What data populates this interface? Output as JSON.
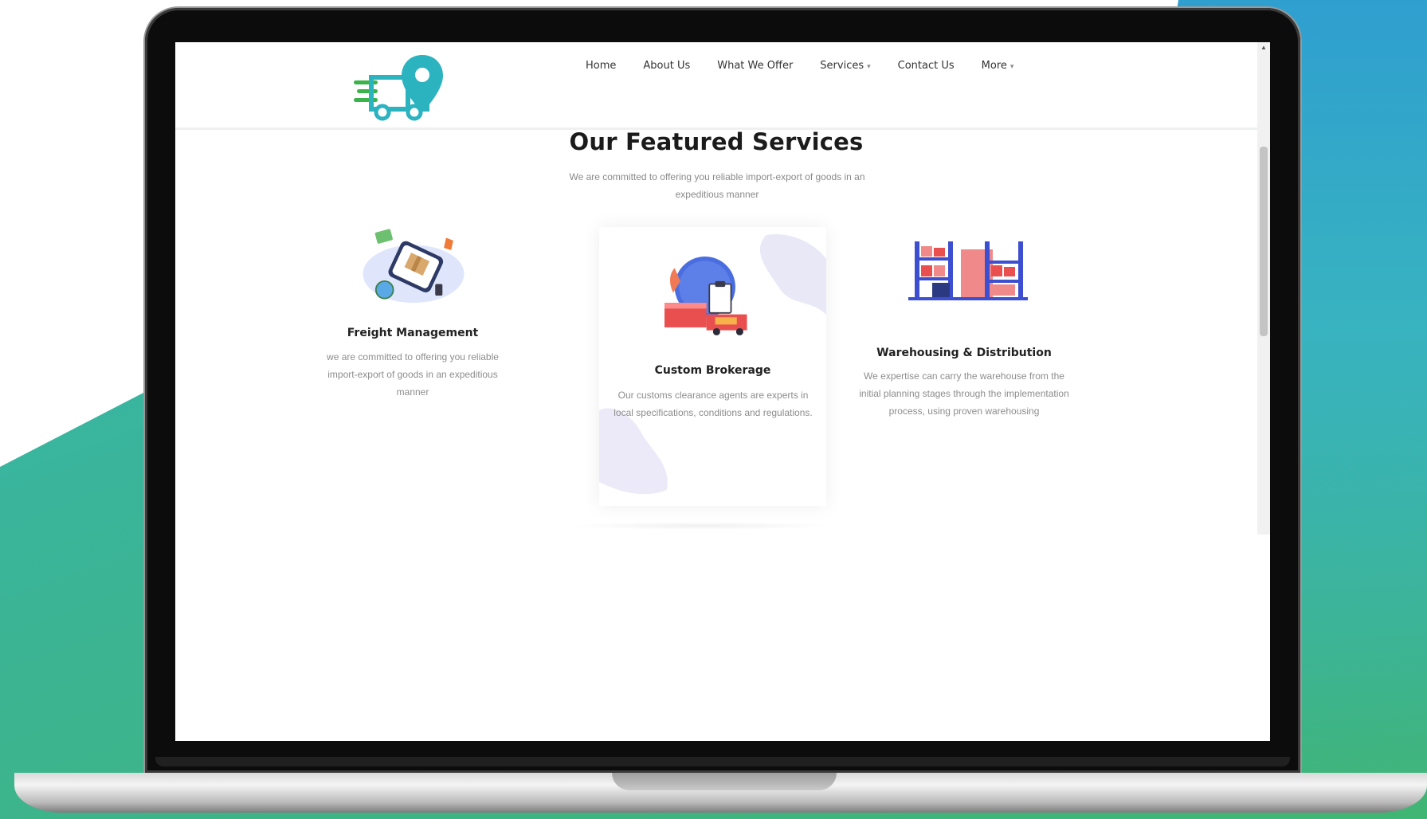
{
  "nav": {
    "home": "Home",
    "about": "About Us",
    "offer": "What We Offer",
    "services": "Services",
    "contact": "Contact Us",
    "more": "More"
  },
  "section": {
    "title": "Our Featured Services",
    "subtitle": "We are committed to offering you reliable import-export of goods in an expeditious manner"
  },
  "cards": [
    {
      "title": "Freight Management",
      "desc": "we are committed to offering you reliable import-export of goods in an expeditious manner",
      "icon": "freight-illustration"
    },
    {
      "title": "Custom Brokerage",
      "desc": "Our customs clearance agents are experts in local specifications, conditions and regulations.",
      "icon": "customs-illustration"
    },
    {
      "title": "Warehousing & Distribution",
      "desc": "We expertise can carry the warehouse from the initial planning stages through the implementation process, using proven warehousing",
      "icon": "warehouse-illustration"
    }
  ],
  "colors": {
    "brand": "#2bb3c0",
    "brand_green": "#3bb34a",
    "bg_gradient_start": "#35b7b8",
    "bg_gradient_end": "#41b572"
  }
}
